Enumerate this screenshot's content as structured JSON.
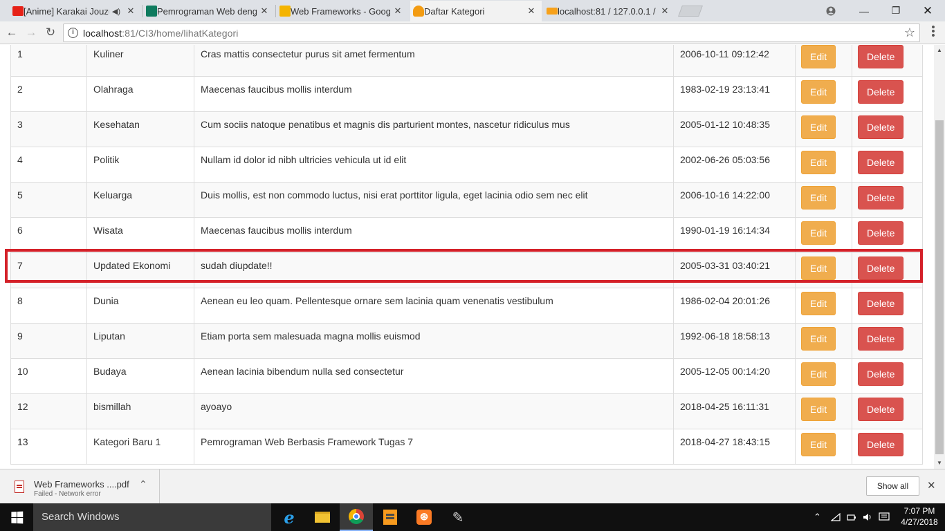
{
  "browser": {
    "tabs": [
      {
        "title": "[Anime] Karakai Jouzu",
        "favicon_color": "#e62117",
        "audio": true
      },
      {
        "title": "Pemrograman Web deng",
        "favicon_color": "#0f7b5f"
      },
      {
        "title": "Web Frameworks - Goog",
        "favicon_color": "#f4b400"
      },
      {
        "title": "Daftar Kategori",
        "favicon_color": "#f39c12",
        "active": true
      },
      {
        "title": "localhost:81 / 127.0.0.1 /",
        "favicon_color": "#f7a11a"
      }
    ],
    "address": {
      "host": "localhost",
      "path": ":81/CI3/home/lihatKategori"
    }
  },
  "table": {
    "edit_label": "Edit",
    "delete_label": "Delete",
    "rows": [
      {
        "id": "1",
        "name": "Kuliner",
        "desc": "Cras mattis consectetur purus sit amet fermentum",
        "date": "2006-10-11 09:12:42"
      },
      {
        "id": "2",
        "name": "Olahraga",
        "desc": "Maecenas faucibus mollis interdum",
        "date": "1983-02-19 23:13:41"
      },
      {
        "id": "3",
        "name": "Kesehatan",
        "desc": "Cum sociis natoque penatibus et magnis dis parturient montes, nascetur ridiculus mus",
        "date": "2005-01-12 10:48:35"
      },
      {
        "id": "4",
        "name": "Politik",
        "desc": "Nullam id dolor id nibh ultricies vehicula ut id elit",
        "date": "2002-06-26 05:03:56"
      },
      {
        "id": "5",
        "name": "Keluarga",
        "desc": "Duis mollis, est non commodo luctus, nisi erat porttitor ligula, eget lacinia odio sem nec elit",
        "date": "2006-10-16 14:22:00"
      },
      {
        "id": "6",
        "name": "Wisata",
        "desc": "Maecenas faucibus mollis interdum",
        "date": "1990-01-19 16:14:34"
      },
      {
        "id": "7",
        "name": "Updated Ekonomi",
        "desc": "sudah diupdate!!",
        "date": "2005-03-31 03:40:21",
        "highlighted": true
      },
      {
        "id": "8",
        "name": "Dunia",
        "desc": "Aenean eu leo quam. Pellentesque ornare sem lacinia quam venenatis vestibulum",
        "date": "1986-02-04 20:01:26"
      },
      {
        "id": "9",
        "name": "Liputan",
        "desc": "Etiam porta sem malesuada magna mollis euismod",
        "date": "1992-06-18 18:58:13"
      },
      {
        "id": "10",
        "name": "Budaya",
        "desc": "Aenean lacinia bibendum nulla sed consectetur",
        "date": "2005-12-05 00:14:20"
      },
      {
        "id": "12",
        "name": "bismillah",
        "desc": "ayoayo",
        "date": "2018-04-25 16:11:31"
      },
      {
        "id": "13",
        "name": "Kategori Baru 1",
        "desc": "Pemrograman Web Berbasis Framework Tugas 7",
        "date": "2018-04-27 18:43:15"
      }
    ]
  },
  "downloads": {
    "file_name": "Web Frameworks ....pdf",
    "status": "Failed - Network error",
    "show_all_label": "Show all"
  },
  "taskbar": {
    "search_placeholder": "Search Windows",
    "time": "7:07 PM",
    "date": "4/27/2018"
  },
  "colors": {
    "edit_button": "#f0ad4e",
    "delete_button": "#d9534f",
    "highlight": "#d42129"
  }
}
